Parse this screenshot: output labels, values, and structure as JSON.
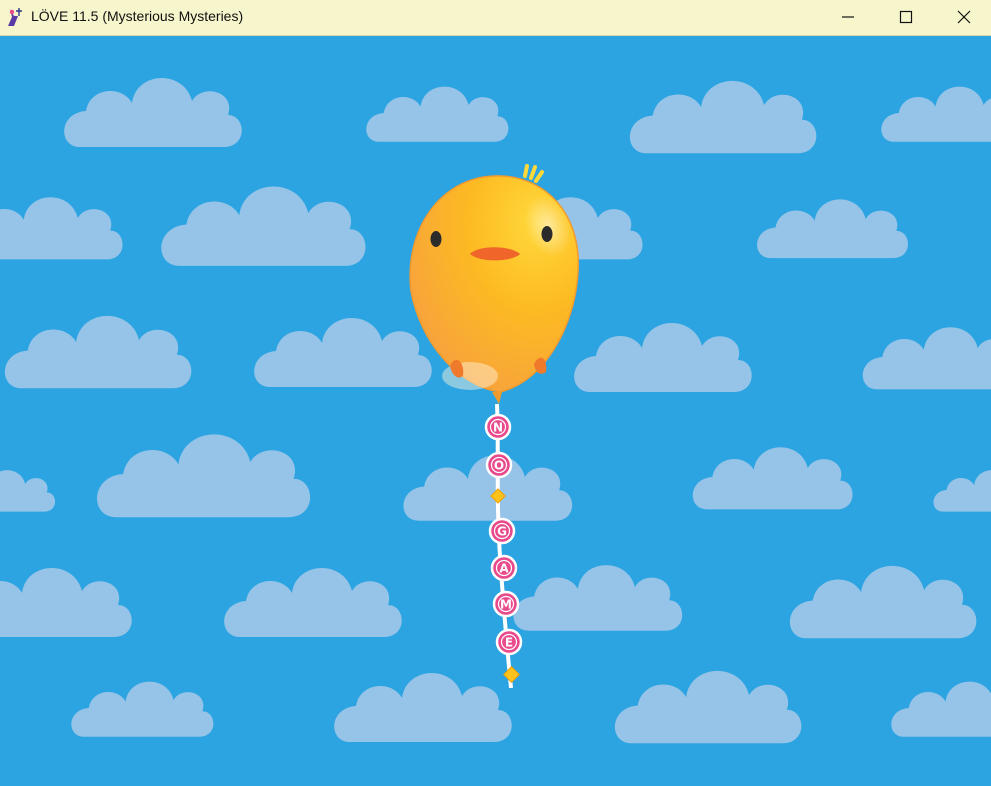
{
  "window": {
    "title": "LÖVE 11.5 (Mysterious Mysteries)",
    "icon": "love-app-icon",
    "controls": [
      "minimize-icon",
      "maximize-icon",
      "close-icon"
    ],
    "titlebar_color": "#f7f5cb"
  },
  "game": {
    "sky_color": "#2ba4e1",
    "cloud_color": "#9cc6e8",
    "balloon_color": "#fbb21e",
    "bead_color": "#e84a8c",
    "string_letters": [
      "N",
      "O",
      "G",
      "A",
      "M",
      "E"
    ]
  }
}
